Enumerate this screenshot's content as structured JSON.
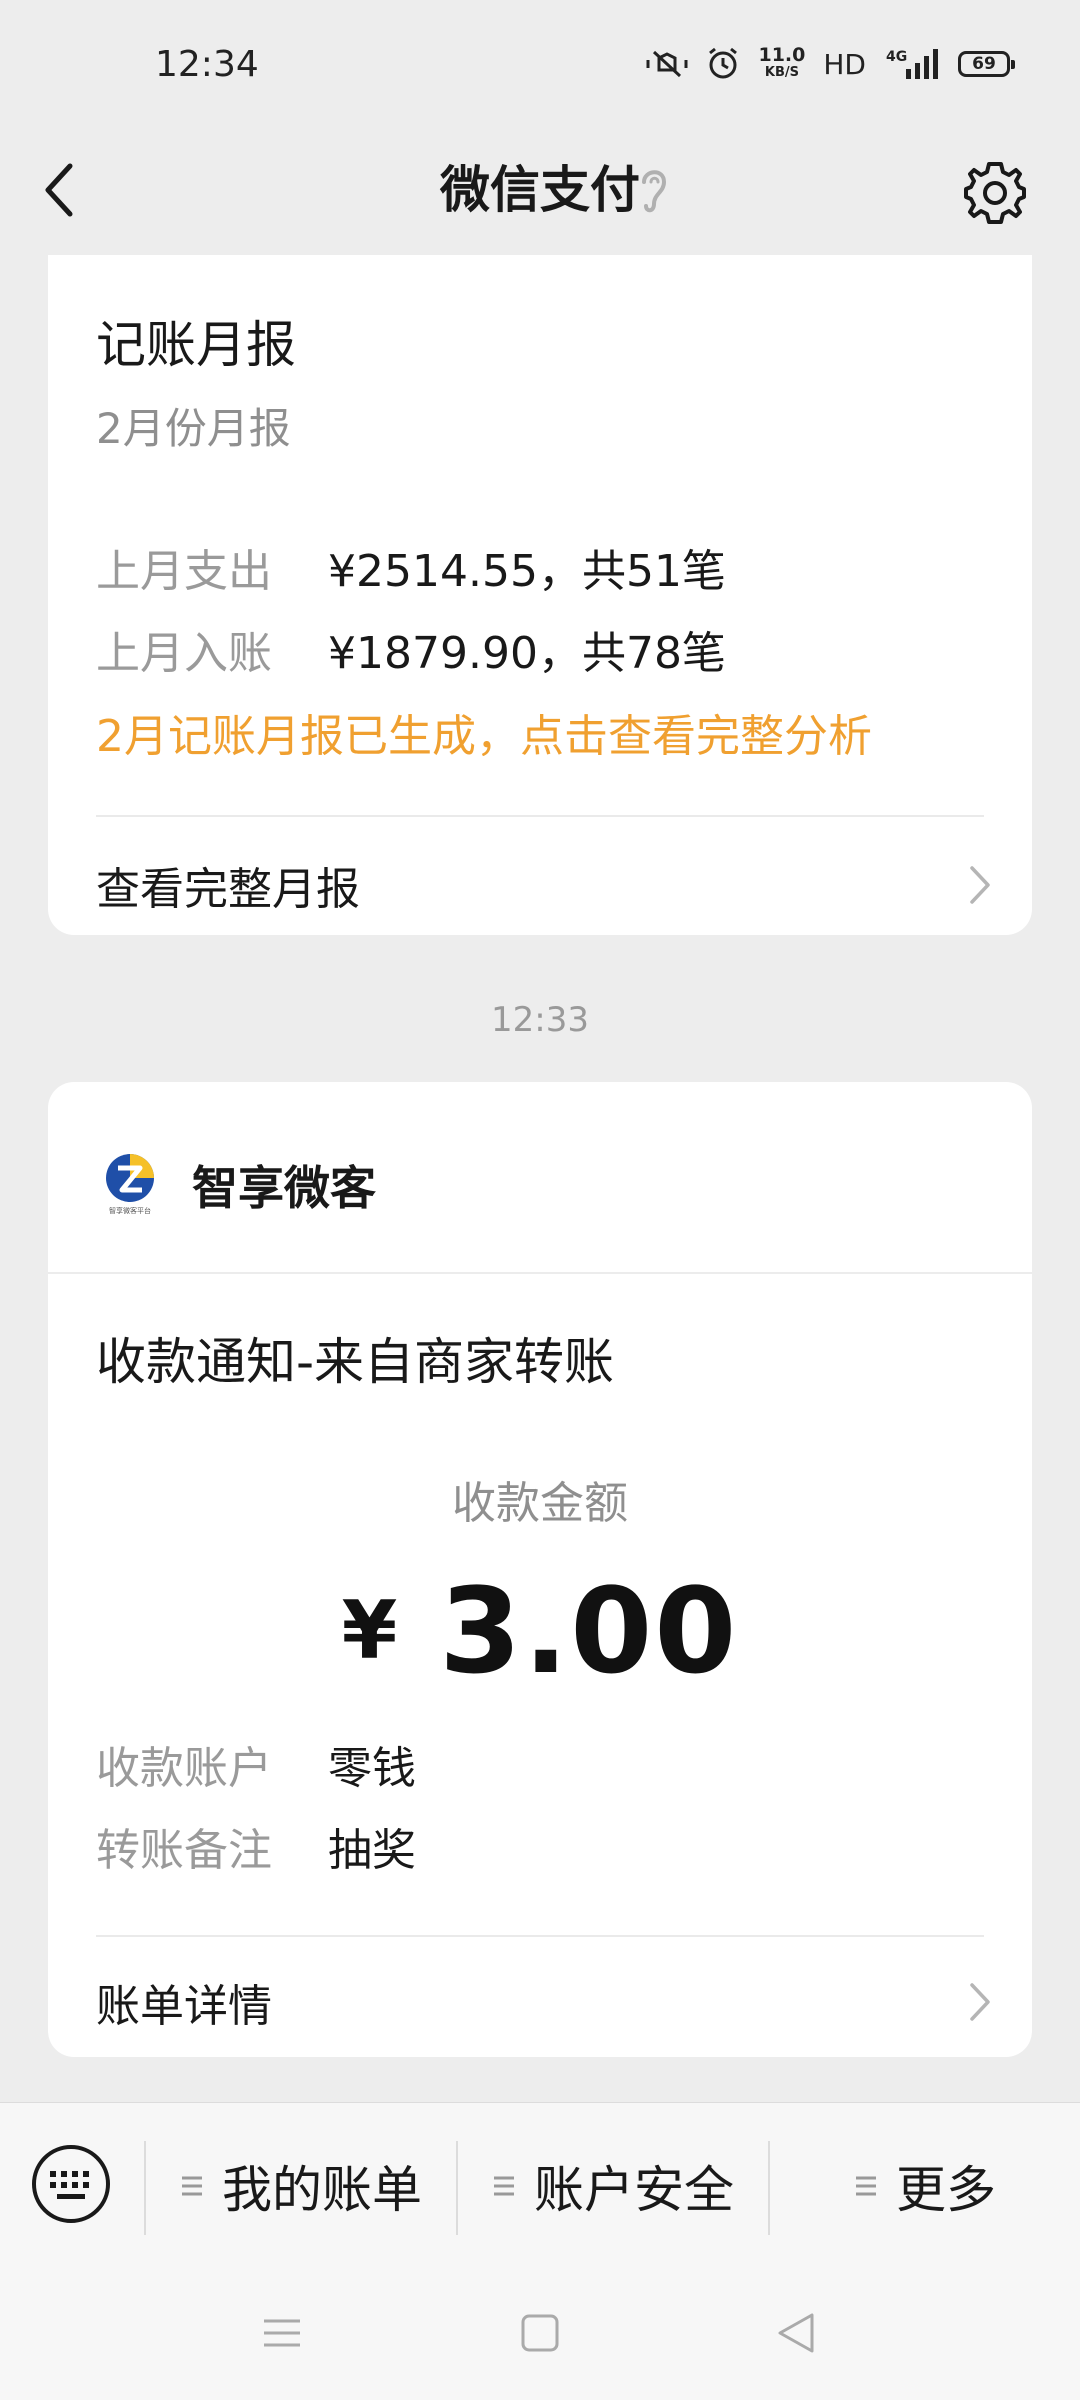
{
  "status_bar": {
    "time": "12:34",
    "net_speed_value": "11.0",
    "net_speed_unit": "KB/S",
    "hd": "HD",
    "signal_label": "4G",
    "battery": "69"
  },
  "nav": {
    "title": "微信支付"
  },
  "report_card": {
    "title": "记账月报",
    "subtitle": "2月份月报",
    "rows": [
      {
        "label": "上月支出",
        "value": "¥2514.55，共51笔"
      },
      {
        "label": "上月入账",
        "value": "¥1879.90，共78笔"
      }
    ],
    "hint": "2月记账月报已生成，点击查看完整分析",
    "link": "查看完整月报"
  },
  "message_time": "12:33",
  "receipt_card": {
    "merchant": "智享微客",
    "merchant_logo_text": "智享微客平台",
    "title": "收款通知-来自商家转账",
    "amount_label": "收款金额",
    "currency": "¥",
    "amount": "3.00",
    "rows": [
      {
        "label": "收款账户",
        "value": "零钱"
      },
      {
        "label": "转账备注",
        "value": "抽奖"
      }
    ],
    "link": "账单详情"
  },
  "bottom_menu": {
    "items": [
      "我的账单",
      "账户安全",
      "更多"
    ]
  },
  "colors": {
    "background": "#ededed",
    "card": "#ffffff",
    "hint": "#f0a030",
    "muted": "#9a9a9a"
  }
}
